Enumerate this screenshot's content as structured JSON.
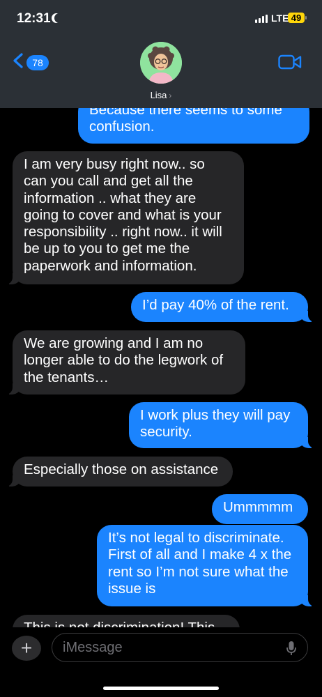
{
  "status_bar": {
    "time": "12:31",
    "network": "LTE",
    "battery": "49"
  },
  "header": {
    "back_count": "78",
    "contact_name": "Lisa"
  },
  "messages": [
    {
      "dir": "out",
      "text": "Because there seems to some\nconfusion."
    },
    {
      "dir": "in",
      "text": "I am very busy right now.. so\ncan you call and get all the\ninformation .. what they are\ngoing to cover and what is your\nresponsibility .. right now.. it will\nbe up to you to get me the\npaperwork and information."
    },
    {
      "dir": "out",
      "text": "I’d pay 40% of the rent."
    },
    {
      "dir": "in",
      "text": "We are growing and I am no\nlonger able to do the legwork of\nthe tenants…"
    },
    {
      "dir": "out",
      "text": "I work plus they will pay\nsecurity."
    },
    {
      "dir": "in",
      "text": "Especially those on assistance"
    },
    {
      "dir": "out",
      "text": "Ummmmm"
    },
    {
      "dir": "out",
      "text": "It’s not legal to discriminate.\nFirst of all and I make 4 x the\nrent so I’m not sure what the\nissue is"
    },
    {
      "dir": "in",
      "text": "This is not discrimination! This"
    }
  ],
  "composer": {
    "placeholder": "iMessage"
  },
  "colors": {
    "outgoing": "#1b84fe",
    "incoming": "#262628",
    "header": "#2b3036",
    "battery": "#ffd60a"
  },
  "icons": [
    "back-chevron-icon",
    "video-camera-icon",
    "plus-icon",
    "microphone-icon",
    "moon-icon",
    "signal-icon",
    "battery-icon"
  ]
}
